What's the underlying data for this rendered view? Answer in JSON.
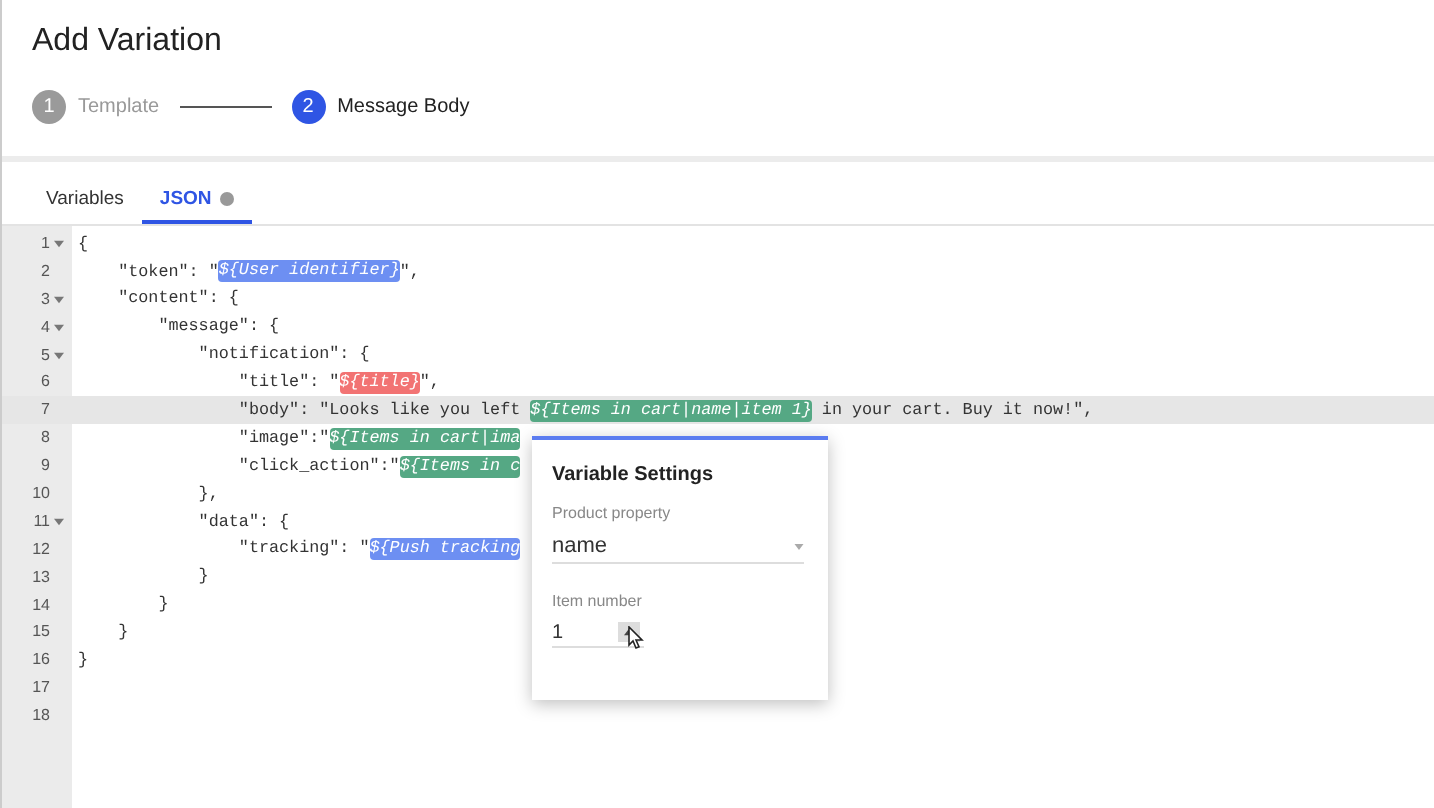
{
  "title": "Add Variation",
  "steps": [
    {
      "number": "1",
      "label": "Template",
      "selected": false
    },
    {
      "number": "2",
      "label": "Message Body",
      "selected": true
    }
  ],
  "tabs": [
    {
      "label": "Variables",
      "selected": false
    },
    {
      "label": "JSON",
      "selected": true
    }
  ],
  "editor": {
    "lines": [
      {
        "number": "1",
        "foldable": true,
        "active": false,
        "segments": [
          {
            "kind": "text",
            "text": "{"
          }
        ]
      },
      {
        "number": "2",
        "foldable": false,
        "active": false,
        "segments": [
          {
            "kind": "text",
            "text": "    \"token\": \""
          },
          {
            "kind": "token",
            "text": "${User identifier}",
            "color": "#6d8ff2"
          },
          {
            "kind": "text",
            "text": "\","
          }
        ]
      },
      {
        "number": "3",
        "foldable": true,
        "active": false,
        "segments": [
          {
            "kind": "text",
            "text": "    \"content\": {"
          }
        ]
      },
      {
        "number": "4",
        "foldable": true,
        "active": false,
        "segments": [
          {
            "kind": "text",
            "text": "        \"message\": {"
          }
        ]
      },
      {
        "number": "5",
        "foldable": true,
        "active": false,
        "segments": [
          {
            "kind": "text",
            "text": "            \"notification\": {"
          }
        ]
      },
      {
        "number": "6",
        "foldable": false,
        "active": false,
        "segments": [
          {
            "kind": "text",
            "text": "                \"title\": \""
          },
          {
            "kind": "token",
            "text": "${title}",
            "color": "#f27373"
          },
          {
            "kind": "text",
            "text": "\","
          }
        ]
      },
      {
        "number": "7",
        "foldable": false,
        "active": true,
        "segments": [
          {
            "kind": "text",
            "text": "                \"body\": \"Looks like you left "
          },
          {
            "kind": "token",
            "text": "${Items in cart|name|item 1}",
            "color": "#55a884"
          },
          {
            "kind": "text",
            "text": " in your cart. Buy it now!\","
          }
        ]
      },
      {
        "number": "8",
        "foldable": false,
        "active": false,
        "segments": [
          {
            "kind": "text",
            "text": "                \"image\":\""
          },
          {
            "kind": "token",
            "text": "${Items in cart|ima",
            "color": "#55a884"
          }
        ]
      },
      {
        "number": "9",
        "foldable": false,
        "active": false,
        "segments": [
          {
            "kind": "text",
            "text": "                \"click_action\":\""
          },
          {
            "kind": "token",
            "text": "${Items in c",
            "color": "#55a884"
          }
        ]
      },
      {
        "number": "10",
        "foldable": false,
        "active": false,
        "segments": [
          {
            "kind": "text",
            "text": "            },"
          }
        ]
      },
      {
        "number": "11",
        "foldable": true,
        "active": false,
        "segments": [
          {
            "kind": "text",
            "text": "            \"data\": {"
          }
        ]
      },
      {
        "number": "12",
        "foldable": false,
        "active": false,
        "segments": [
          {
            "kind": "text",
            "text": "                \"tracking\": \""
          },
          {
            "kind": "token",
            "text": "${Push tracking",
            "color": "#6d8ff2"
          }
        ]
      },
      {
        "number": "13",
        "foldable": false,
        "active": false,
        "segments": [
          {
            "kind": "text",
            "text": "            }"
          }
        ]
      },
      {
        "number": "14",
        "foldable": false,
        "active": false,
        "segments": [
          {
            "kind": "text",
            "text": "        }"
          }
        ]
      },
      {
        "number": "15",
        "foldable": false,
        "active": false,
        "segments": [
          {
            "kind": "text",
            "text": "    }"
          }
        ]
      },
      {
        "number": "16",
        "foldable": false,
        "active": false,
        "segments": [
          {
            "kind": "text",
            "text": "}"
          }
        ]
      },
      {
        "number": "17",
        "foldable": false,
        "active": false
      },
      {
        "number": "18",
        "foldable": false,
        "active": false
      }
    ]
  },
  "popup": {
    "title": "Variable Settings",
    "product_property": {
      "label": "Product property",
      "value": "name"
    },
    "item_number": {
      "label": "Item number",
      "value": "1"
    }
  }
}
